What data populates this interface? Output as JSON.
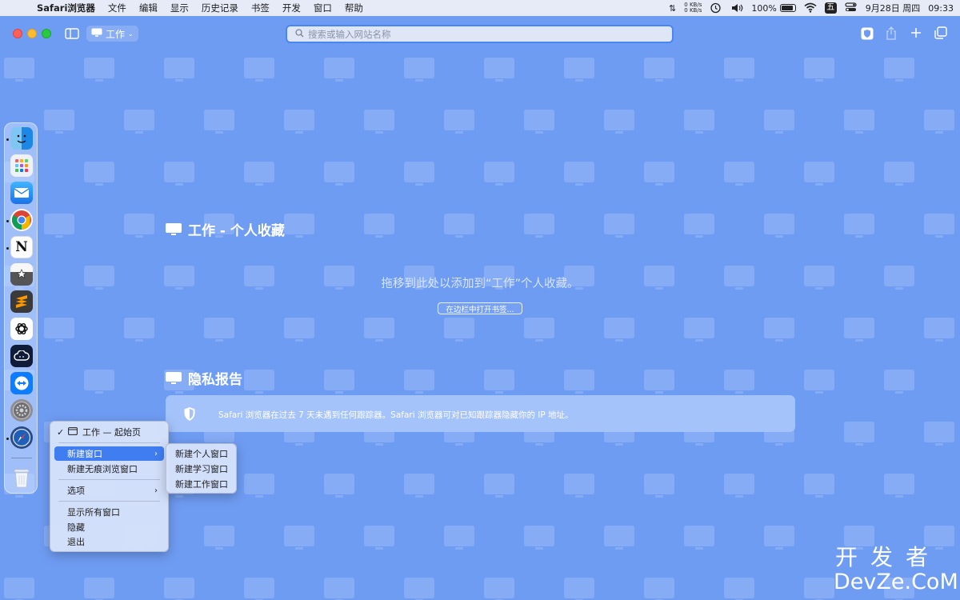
{
  "menubar": {
    "items": [
      "Safari浏览器",
      "文件",
      "编辑",
      "显示",
      "历史记录",
      "书签",
      "开发",
      "窗口",
      "帮助"
    ],
    "netspeed_up": "0 KB/s",
    "netspeed_down": "0 KB/s",
    "battery": "100%",
    "ime_label": "五",
    "date": "9月28日 周四",
    "time": "09:33"
  },
  "toolbar": {
    "tab_group_label": "工作",
    "address_placeholder": "搜索或输入网站名称"
  },
  "favorites": {
    "title": "工作 - 个人收藏",
    "hint": "拖移到此处以添加到“工作”个人收藏。",
    "open_button": "在边栏中打开书签..."
  },
  "privacy": {
    "title": "隐私报告",
    "message": "Safari 浏览器在过去 7 天未遇到任何跟踪器。Safari 浏览器可对已知跟踪器隐藏你的 IP 地址。"
  },
  "dock": {
    "apps": [
      "finder-icon",
      "launchpad-icon",
      "mail-icon",
      "chrome-icon",
      "notion-icon",
      "reeder-icon",
      "sublime-text-icon",
      "chatgpt-icon",
      "cloud-app-icon",
      "teamviewer-icon",
      "system-settings-icon",
      "safari-icon",
      "trash-icon"
    ]
  },
  "context_menu": {
    "current_window": "工作 — 起始页",
    "new_window": "新建窗口",
    "new_private_window": "新建无痕浏览窗口",
    "options": "选项",
    "show_all_windows": "显示所有窗口",
    "hide": "隐藏",
    "quit": "退出"
  },
  "submenu": {
    "items": [
      "新建个人窗口",
      "新建学习窗口",
      "新建工作窗口"
    ]
  },
  "watermark": {
    "top": "开发者",
    "bottom": "DevZe.CoM"
  },
  "colors": {
    "background": "#6f9cf3",
    "accent": "#3f7df0"
  }
}
